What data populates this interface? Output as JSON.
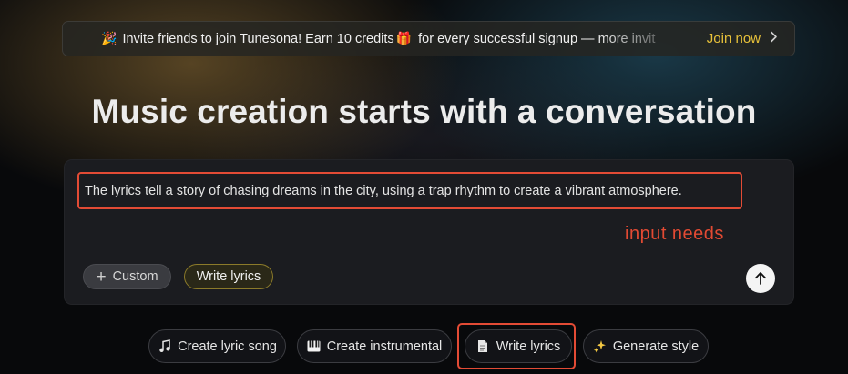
{
  "banner": {
    "icon": "party-popper-icon",
    "text_before": "Invite friends to join Tunesona! Earn 10 credits",
    "gift_icon": "gift-icon",
    "text_after": " for every successful signup — more invit",
    "cta_label": "Join now",
    "cta_icon": "chevron-right-icon"
  },
  "hero": {
    "title": "Music creation starts with a conversation"
  },
  "composer": {
    "prompt_value": "The lyrics tell a story of chasing dreams in the city, using a trap rhythm to create a vibrant atmosphere.",
    "annotation": "input needs",
    "custom_label": "Custom",
    "mode_chip_label": "Write lyrics",
    "send_icon": "arrow-up-icon"
  },
  "suggestions": [
    {
      "label": "Create lyric song",
      "icon": "music-note-icon"
    },
    {
      "label": "Create instrumental",
      "icon": "piano-icon"
    },
    {
      "label": "Write lyrics",
      "icon": "document-icon"
    },
    {
      "label": "Generate style",
      "icon": "sparkles-icon"
    }
  ],
  "colors": {
    "accent_yellow": "#e8c23a",
    "highlight_red": "#e34b35",
    "card_bg": "#1b1c20",
    "page_bg": "#08090b"
  }
}
